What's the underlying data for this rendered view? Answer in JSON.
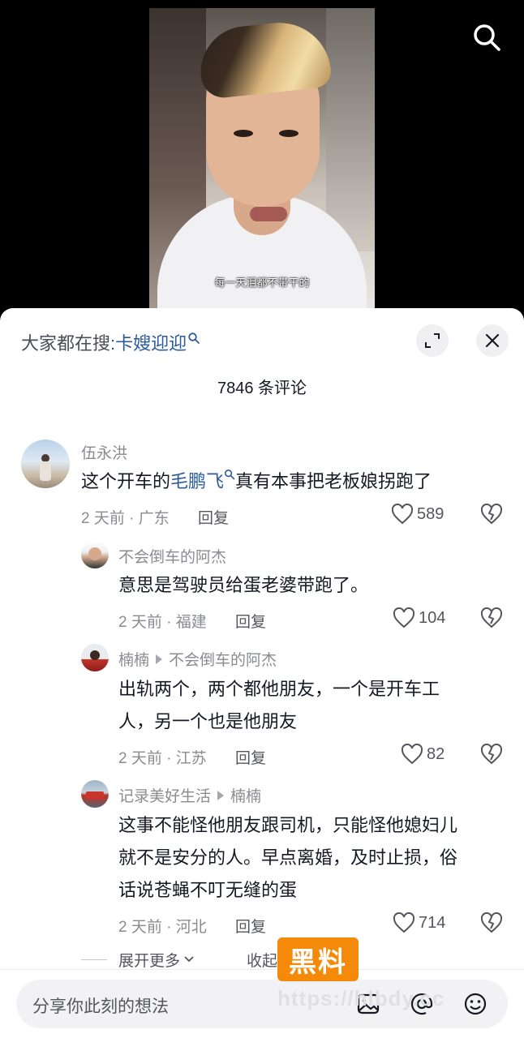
{
  "video": {
    "subtitle": "每一天泪都不带干的",
    "search_icon": "search-icon"
  },
  "sheet": {
    "hot_search_prefix": "大家都在搜:",
    "hot_search_keyword": "卡嫂迎迎",
    "comment_count": "7846 条评论",
    "expand_icon": "expand-icon",
    "close_icon": "close-icon"
  },
  "comments": [
    {
      "name": "伍永洪",
      "text_before": "这个开车的",
      "keyword": "毛鹏飞",
      "text_after": "真有本事把老板娘拐跑了",
      "meta": "2 天前 · 广东",
      "reply_label": "回复",
      "likes": "589"
    }
  ],
  "replies": [
    {
      "name": "不会倒车的阿杰",
      "text": "意思是驾驶员给蛋老婆带跑了。",
      "meta": "2 天前 · 福建",
      "reply_label": "回复",
      "likes": "104"
    },
    {
      "name": "楠楠",
      "reply_to": "不会倒车的阿杰",
      "text_line1": "出轨两个，两个都他朋友，一个是开车工",
      "text_line2": "人，另一个也是他朋友",
      "meta": "2 天前 · 江苏",
      "reply_label": "回复",
      "likes": "82"
    },
    {
      "name": "记录美好生活",
      "reply_to": "楠楠",
      "text_line1": "这事不能怪他朋友跟司机，只能怪他媳妇儿",
      "text_line2": "就不是安分的人。早点离婚，及时止损，俗",
      "text_line3": "话说苍蝇不叮无缝的蛋",
      "meta": "2 天前 · 河北",
      "reply_label": "回复",
      "likes": "714"
    }
  ],
  "footer": {
    "expand_more": "展开更多",
    "collapse": "收起",
    "watermark": "黑料",
    "watermark_url": "https://hlbdy.cc",
    "input_placeholder": "分享你此刻的想法"
  },
  "colors": {
    "keyword": "#2b5b9c",
    "watermark": "#f58a0a"
  }
}
